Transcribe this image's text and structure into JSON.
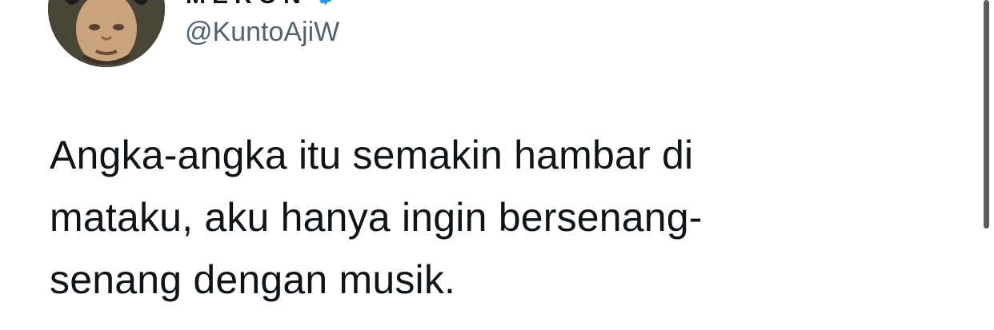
{
  "user": {
    "display_name": "MERON",
    "handle": "@KuntoAjiW",
    "verified": true,
    "verified_color": "#1d9bf0",
    "avatar_icon": "profile-photo"
  },
  "tweet": {
    "lines": [
      "Angka-angka itu semakin hambar di",
      "mataku, aku hanya ingin bersenang-",
      "senang dengan musik."
    ]
  },
  "colors": {
    "text": "#0f1419",
    "secondary_text": "#536471",
    "background": "#ffffff",
    "scrollbar": "#5c5c5c"
  }
}
